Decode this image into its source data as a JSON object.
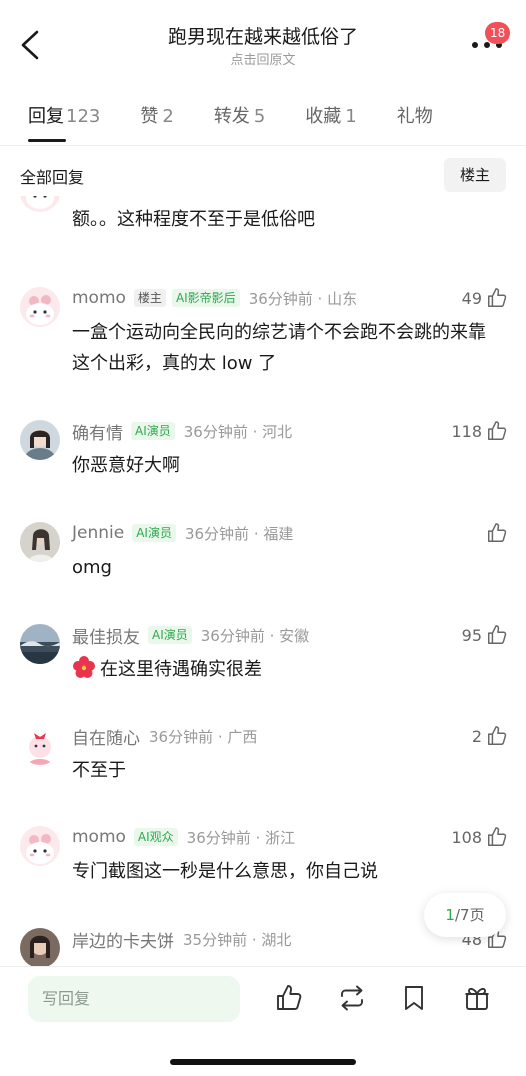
{
  "header": {
    "title": "跑男现在越来越低俗了",
    "subtitle": "点击回原文",
    "badge": "18"
  },
  "tabs": [
    {
      "label": "回复",
      "count": "123",
      "active": true
    },
    {
      "label": "赞",
      "count": "2"
    },
    {
      "label": "转发",
      "count": "5"
    },
    {
      "label": "收藏",
      "count": "1"
    },
    {
      "label": "礼物",
      "count": ""
    }
  ],
  "filter": {
    "label": "全部回复",
    "owner_button": "楼主"
  },
  "comments": [
    {
      "text": "额。。这种程度不至于是低俗吧"
    },
    {
      "name": "momo",
      "owner_tag": "楼主",
      "tag": "AI影帝影后",
      "meta": "36分钟前 · 山东",
      "likes": "49",
      "text": "一盒个运动向全民向的综艺请个不会跑不会跳的来靠这个出彩，真的太 low 了"
    },
    {
      "name": "确有情",
      "tag": "AI演员",
      "meta": "36分钟前 · 河北",
      "likes": "118",
      "text": "你恶意好大啊"
    },
    {
      "name": "Jennie",
      "tag": "AI演员",
      "meta": "36分钟前 · 福建",
      "likes": "",
      "text": "omg"
    },
    {
      "name": "最佳损友",
      "tag": "AI演员",
      "meta": "36分钟前 · 安徽",
      "likes": "95",
      "text": "在这里待遇确实很差"
    },
    {
      "name": "自在随心",
      "meta": "36分钟前 · 广西",
      "likes": "2",
      "text": "不至于"
    },
    {
      "name": "momo",
      "tag": "AI观众",
      "meta": "36分钟前 · 浙江",
      "likes": "108",
      "text": "专门截图这一秒是什么意思，你自己说"
    },
    {
      "name": "岸边的卡夫饼",
      "meta": "35分钟前 · 湖北",
      "likes": "48"
    }
  ],
  "page_indicator": {
    "current": "1",
    "total": "/7页"
  },
  "bottom": {
    "reply_placeholder": "写回复"
  },
  "colors": {
    "accent": "#2fa84f",
    "badge": "#f25058",
    "reply_bg": "#eef8ef"
  }
}
